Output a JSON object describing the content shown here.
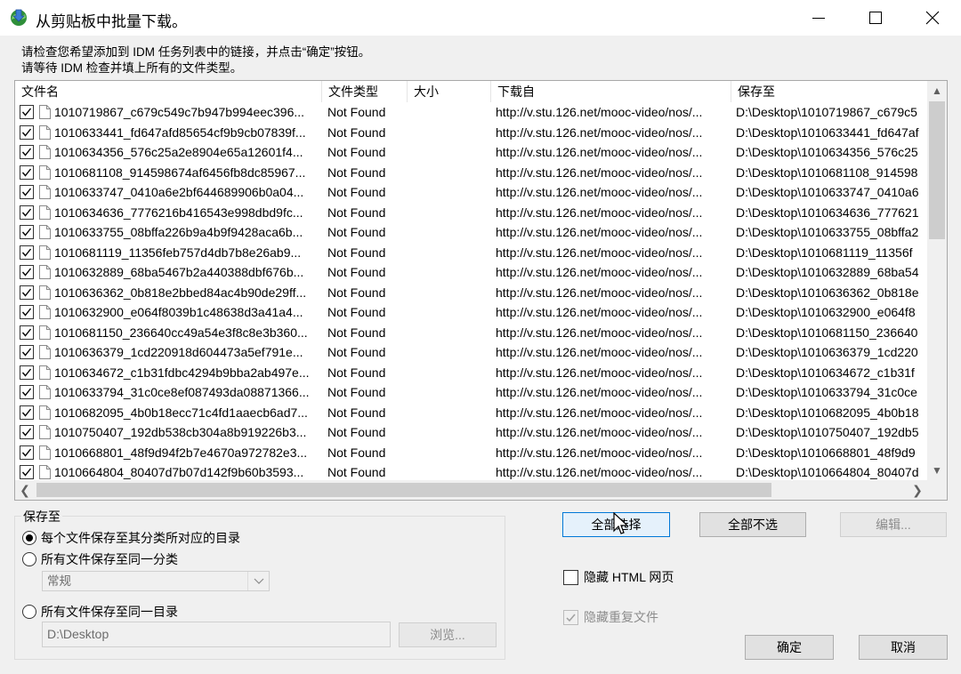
{
  "window": {
    "title": "从剪贴板中批量下载。"
  },
  "instructions": {
    "line1": "请检查您希望添加到 IDM 任务列表中的链接，并点击“确定”按钮。",
    "line2": "请等待 IDM 检查并填上所有的文件类型。"
  },
  "table": {
    "columns": [
      "文件名",
      "文件类型",
      "大小",
      "下载自",
      "保存至"
    ],
    "rows": [
      {
        "name": "1010719867_c679c549c7b947b994eec396...",
        "type": "Not Found",
        "size": "",
        "from": "http://v.stu.126.net/mooc-video/nos/...",
        "save": "D:\\Desktop\\1010719867_c679c5"
      },
      {
        "name": "1010633441_fd647afd85654cf9b9cb07839f...",
        "type": "Not Found",
        "size": "",
        "from": "http://v.stu.126.net/mooc-video/nos/...",
        "save": "D:\\Desktop\\1010633441_fd647af"
      },
      {
        "name": "1010634356_576c25a2e8904e65a12601f4...",
        "type": "Not Found",
        "size": "",
        "from": "http://v.stu.126.net/mooc-video/nos/...",
        "save": "D:\\Desktop\\1010634356_576c25"
      },
      {
        "name": "1010681108_914598674af6456fb8dc85967...",
        "type": "Not Found",
        "size": "",
        "from": "http://v.stu.126.net/mooc-video/nos/...",
        "save": "D:\\Desktop\\1010681108_914598"
      },
      {
        "name": "1010633747_0410a6e2bf644689906b0a04...",
        "type": "Not Found",
        "size": "",
        "from": "http://v.stu.126.net/mooc-video/nos/...",
        "save": "D:\\Desktop\\1010633747_0410a6"
      },
      {
        "name": "1010634636_7776216b416543e998dbd9fc...",
        "type": "Not Found",
        "size": "",
        "from": "http://v.stu.126.net/mooc-video/nos/...",
        "save": "D:\\Desktop\\1010634636_777621"
      },
      {
        "name": "1010633755_08bffa226b9a4b9f9428aca6b...",
        "type": "Not Found",
        "size": "",
        "from": "http://v.stu.126.net/mooc-video/nos/...",
        "save": "D:\\Desktop\\1010633755_08bffa2"
      },
      {
        "name": "1010681119_11356feb757d4db7b8e26ab9...",
        "type": "Not Found",
        "size": "",
        "from": "http://v.stu.126.net/mooc-video/nos/...",
        "save": "D:\\Desktop\\1010681119_11356f"
      },
      {
        "name": "1010632889_68ba5467b2a440388dbf676b...",
        "type": "Not Found",
        "size": "",
        "from": "http://v.stu.126.net/mooc-video/nos/...",
        "save": "D:\\Desktop\\1010632889_68ba54"
      },
      {
        "name": "1010636362_0b818e2bbed84ac4b90de29ff...",
        "type": "Not Found",
        "size": "",
        "from": "http://v.stu.126.net/mooc-video/nos/...",
        "save": "D:\\Desktop\\1010636362_0b818e"
      },
      {
        "name": "1010632900_e064f8039b1c48638d3a41a4...",
        "type": "Not Found",
        "size": "",
        "from": "http://v.stu.126.net/mooc-video/nos/...",
        "save": "D:\\Desktop\\1010632900_e064f8"
      },
      {
        "name": "1010681150_236640cc49a54e3f8c8e3b360...",
        "type": "Not Found",
        "size": "",
        "from": "http://v.stu.126.net/mooc-video/nos/...",
        "save": "D:\\Desktop\\1010681150_236640"
      },
      {
        "name": "1010636379_1cd220918d604473a5ef791e...",
        "type": "Not Found",
        "size": "",
        "from": "http://v.stu.126.net/mooc-video/nos/...",
        "save": "D:\\Desktop\\1010636379_1cd220"
      },
      {
        "name": "1010634672_c1b31fdbc4294b9bba2ab497e...",
        "type": "Not Found",
        "size": "",
        "from": "http://v.stu.126.net/mooc-video/nos/...",
        "save": "D:\\Desktop\\1010634672_c1b31f"
      },
      {
        "name": "1010633794_31c0ce8ef087493da08871366...",
        "type": "Not Found",
        "size": "",
        "from": "http://v.stu.126.net/mooc-video/nos/...",
        "save": "D:\\Desktop\\1010633794_31c0ce"
      },
      {
        "name": "1010682095_4b0b18ecc71c4fd1aaecb6ad7...",
        "type": "Not Found",
        "size": "",
        "from": "http://v.stu.126.net/mooc-video/nos/...",
        "save": "D:\\Desktop\\1010682095_4b0b18"
      },
      {
        "name": "1010750407_192db538cb304a8b919226b3...",
        "type": "Not Found",
        "size": "",
        "from": "http://v.stu.126.net/mooc-video/nos/...",
        "save": "D:\\Desktop\\1010750407_192db5"
      },
      {
        "name": "1010668801_48f9d94f2b7e4670a972782e3...",
        "type": "Not Found",
        "size": "",
        "from": "http://v.stu.126.net/mooc-video/nos/...",
        "save": "D:\\Desktop\\1010668801_48f9d9"
      },
      {
        "name": "1010664804_80407d7b07d142f9b60b3593...",
        "type": "Not Found",
        "size": "",
        "from": "http://v.stu.126.net/mooc-video/nos/...",
        "save": "D:\\Desktop\\1010664804_80407d"
      }
    ]
  },
  "save_group": {
    "legend": "保存至",
    "option1": "每个文件保存至其分类所对应的目录",
    "option2": "所有文件保存至同一分类",
    "category_value": "常规",
    "option3": "所有文件保存至同一目录",
    "path_value": "D:\\Desktop",
    "browse_label": "浏览..."
  },
  "buttons": {
    "select_all": "全部选择",
    "select_none": "全部不选",
    "edit": "编辑...",
    "ok": "确定",
    "cancel": "取消"
  },
  "options": {
    "hide_html": "隐藏 HTML 网页",
    "hide_duplicates": "隐藏重复文件"
  },
  "icons": {
    "app": "idm-globe-icon",
    "file": "file-icon",
    "check": "checkmark-icon"
  }
}
